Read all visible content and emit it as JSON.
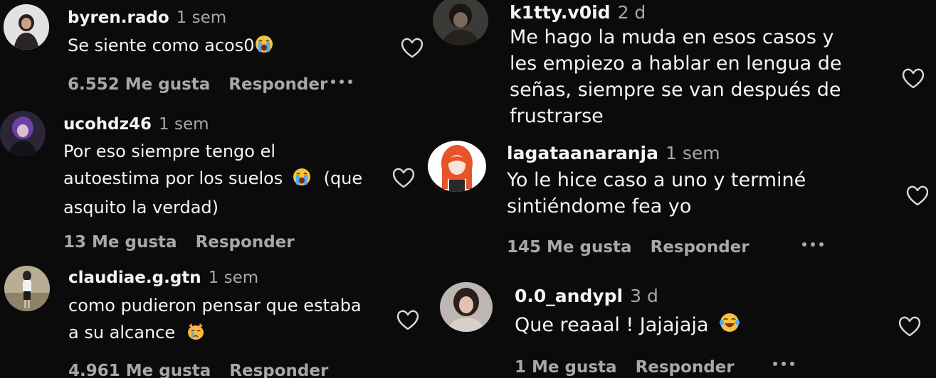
{
  "comments": [
    {
      "user": "byren.rado",
      "time": "1 sem",
      "text": "Se siente como acos0",
      "emoji": "loudly-crying-face",
      "likes": "6.552 Me gusta",
      "reply": "Responder"
    },
    {
      "user": "ucohdz46",
      "time": "1 sem",
      "text_l1": "Por eso siempre tengo el",
      "text_l2_a": "autoestima por los suelos",
      "text_l2_b": " (que",
      "text_l3": "asquito la verdad)",
      "emoji": "loudly-crying-face",
      "likes": "13 Me gusta",
      "reply": "Responder"
    },
    {
      "user": "claudiae.g.gtn",
      "time": "1 sem",
      "text_l1": "como pudieron pensar que estaba",
      "text_l2": "a su alcance",
      "emoji": "crying-cat-face",
      "likes": "4.961 Me gusta",
      "reply": "Responder"
    },
    {
      "user": "k1tty.v0id",
      "time": "2 d",
      "text_l1": "Me hago la muda en esos casos y",
      "text_l2": "les empiezo a hablar en lengua de",
      "text_l3": "señas, siempre se van después de",
      "text_l4": "frustrarse"
    },
    {
      "user": "lagataanaranja",
      "time": "1 sem",
      "text_l1": "Yo le hice caso a uno y terminé",
      "text_l2": "sintiéndome fea yo",
      "likes": "145 Me gusta",
      "reply": "Responder"
    },
    {
      "user": "0.0_andypl",
      "time": "3 d",
      "text": "Que reaaal ! Jajajaja",
      "emoji": "face-with-tears-of-joy",
      "likes": "1 Me gusta",
      "reply": "Responder"
    }
  ],
  "icons": {
    "like": "heart-outline-icon",
    "more": "more-options-icon"
  },
  "colors": {
    "background": "#0b0b0c",
    "text": "#f5f5f5",
    "muted": "#a8a8a8"
  }
}
